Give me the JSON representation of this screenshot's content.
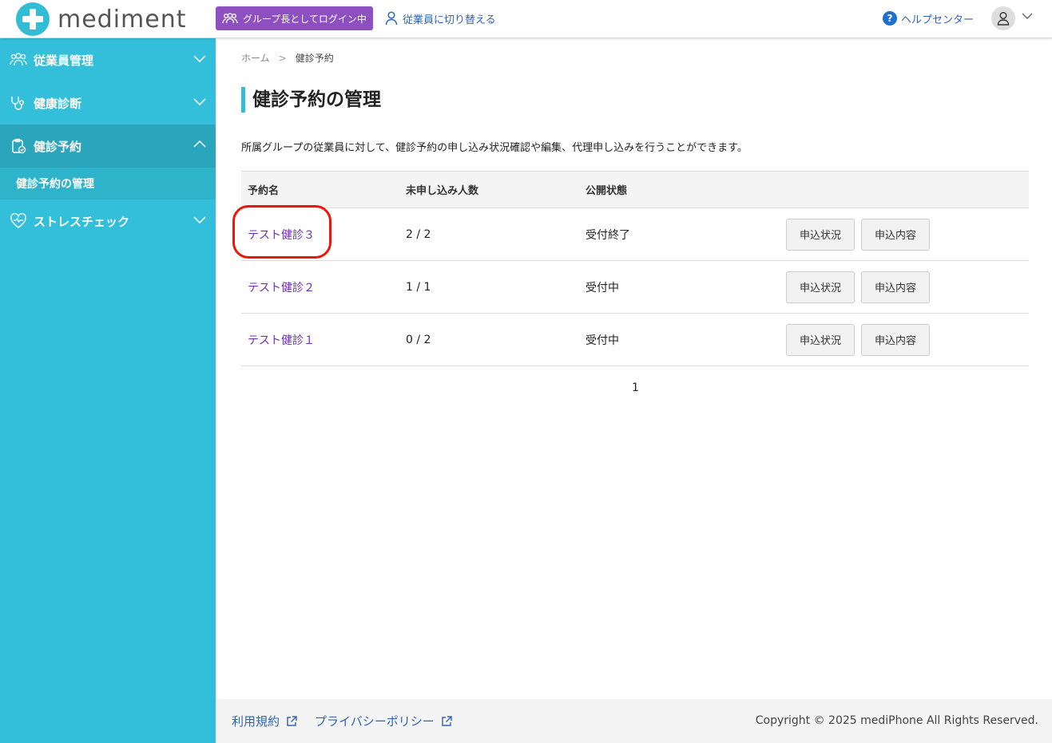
{
  "header": {
    "logo_text": "mediment",
    "group_badge": "グループ長としてログイン中",
    "switch_employee": "従業員に切り替える",
    "help_center": "ヘルプセンター"
  },
  "sidebar": {
    "items": [
      {
        "label": "従業員管理"
      },
      {
        "label": "健康診断"
      },
      {
        "label": "健診予約"
      },
      {
        "label": "ストレスチェック"
      }
    ],
    "sub_item": "健診予約の管理"
  },
  "breadcrumb": {
    "home": "ホーム",
    "separator": ">",
    "current": "健診予約"
  },
  "page": {
    "title": "健診予約の管理",
    "description": "所属グループの従業員に対して、健診予約の申し込み状況確認や編集、代理申し込みを行うことができます。"
  },
  "table": {
    "headers": {
      "name": "予約名",
      "count": "未申し込み人数",
      "status": "公開状態"
    },
    "rows": [
      {
        "name": "テスト健診３",
        "count": "2 / 2",
        "status": "受付終了",
        "btn_status": "申込状況",
        "btn_content": "申込内容"
      },
      {
        "name": "テスト健診２",
        "count": "1 / 1",
        "status": "受付中",
        "btn_status": "申込状況",
        "btn_content": "申込内容"
      },
      {
        "name": "テスト健診１",
        "count": "0 / 2",
        "status": "受付中",
        "btn_status": "申込状況",
        "btn_content": "申込内容"
      }
    ]
  },
  "pagination": {
    "current_page": "1"
  },
  "footer": {
    "terms": "利用規約",
    "privacy": "プライバシーポリシー",
    "copyright": "Copyright © 2025 mediPhone All Rights Reserved."
  },
  "colors": {
    "accent": "#33bcd6",
    "sidebar": "#33bfd9",
    "badge": "#8e4fc0",
    "link": "#2e65b5",
    "row_link": "#6b2fb8",
    "highlight": "#e8190a"
  }
}
